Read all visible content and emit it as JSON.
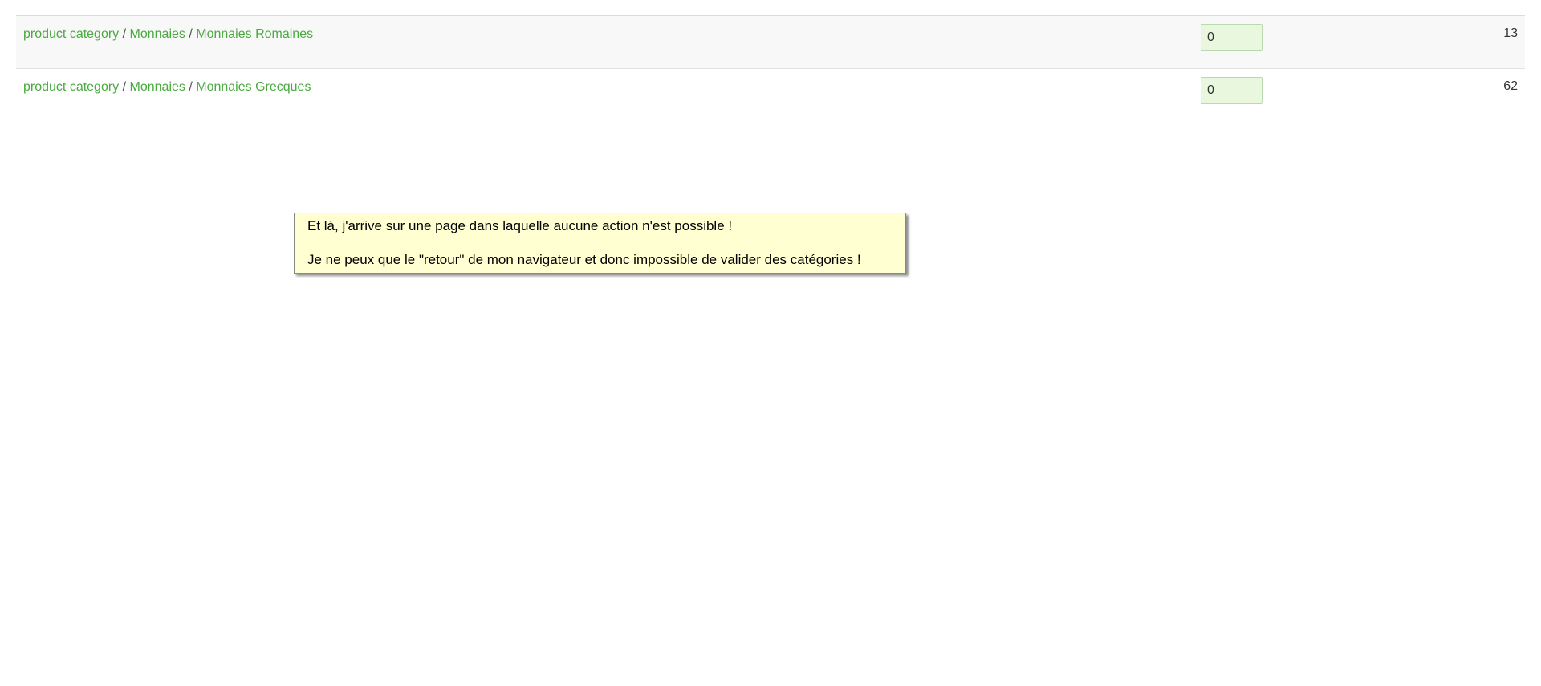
{
  "rows": [
    {
      "path": [
        "product category",
        "Monnaies",
        "Monnaies Romaines"
      ],
      "separator": "/",
      "position_value": "0",
      "count": "13"
    },
    {
      "path": [
        "product category",
        "Monnaies",
        "Monnaies Grecques"
      ],
      "separator": "/",
      "position_value": "0",
      "count": "62"
    }
  ],
  "annotation": {
    "line1": "Et là, j'arrive sur une page dans laquelle aucune action n'est possible !",
    "line2": "Je ne peux que le \"retour\" de mon navigateur et donc impossible de valider des catégories !"
  },
  "colors": {
    "link": "#4aaa3f",
    "input_bg": "#e8f7de",
    "note_bg": "#ffffd2"
  }
}
